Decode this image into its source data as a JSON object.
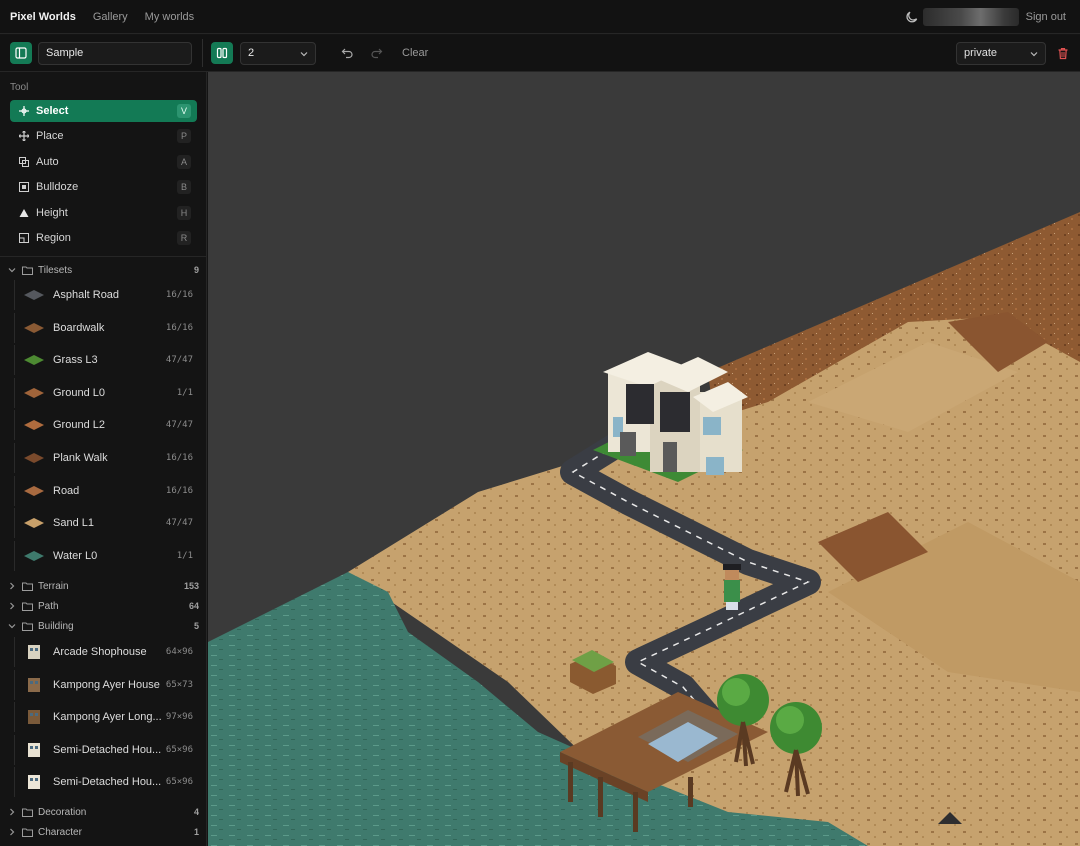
{
  "nav": {
    "brand": "Pixel Worlds",
    "links": [
      "Gallery",
      "My worlds"
    ],
    "sign_out": "Sign out"
  },
  "toolbar": {
    "world_name": "Sample",
    "layer_value": "2",
    "clear_label": "Clear",
    "visibility_value": "private"
  },
  "tools": {
    "section_label": "Tool",
    "items": [
      {
        "label": "Select",
        "key": "V",
        "icon": "crosshair-icon",
        "active": true
      },
      {
        "label": "Place",
        "key": "P",
        "icon": "move-icon"
      },
      {
        "label": "Auto",
        "key": "A",
        "icon": "copy-icon"
      },
      {
        "label": "Bulldoze",
        "key": "B",
        "icon": "bulldoze-icon"
      },
      {
        "label": "Height",
        "key": "H",
        "icon": "triangle-icon"
      },
      {
        "label": "Region",
        "key": "R",
        "icon": "region-icon"
      }
    ]
  },
  "groups": {
    "tilesets": {
      "label": "Tilesets",
      "count": "9",
      "expanded": true
    },
    "terrain": {
      "label": "Terrain",
      "count": "153",
      "expanded": false
    },
    "path": {
      "label": "Path",
      "count": "64",
      "expanded": false
    },
    "building": {
      "label": "Building",
      "count": "5",
      "expanded": true
    },
    "decoration": {
      "label": "Decoration",
      "count": "4",
      "expanded": false
    },
    "character": {
      "label": "Character",
      "count": "1",
      "expanded": false
    }
  },
  "tilesets": [
    {
      "label": "Asphalt Road",
      "count": "16/16",
      "color": "#55585e"
    },
    {
      "label": "Boardwalk",
      "count": "16/16",
      "color": "#8a5a34"
    },
    {
      "label": "Grass L3",
      "count": "47/47",
      "color": "#4d8a32"
    },
    {
      "label": "Ground L0",
      "count": "1/1",
      "color": "#a0643a"
    },
    {
      "label": "Ground L2",
      "count": "47/47",
      "color": "#b06c3e"
    },
    {
      "label": "Plank Walk",
      "count": "16/16",
      "color": "#7a4a2c"
    },
    {
      "label": "Road",
      "count": "16/16",
      "color": "#a86a40"
    },
    {
      "label": "Sand L1",
      "count": "47/47",
      "color": "#c8a06a"
    },
    {
      "label": "Water L0",
      "count": "1/1",
      "color": "#3e7a6c"
    }
  ],
  "buildings": [
    {
      "label": "Arcade Shophouse",
      "count": "64×96"
    },
    {
      "label": "Kampong Ayer House",
      "count": "65×73"
    },
    {
      "label": "Kampong Ayer Long...",
      "count": "97×96"
    },
    {
      "label": "Semi-Detached Hou...",
      "count": "65×96"
    },
    {
      "label": "Semi-Detached Hou...",
      "count": "65×96"
    }
  ],
  "colors": {
    "accent": "#137a55",
    "canvas_bg": "#3a3a3a",
    "water": "#3f7a6d",
    "sand": "#c6a26e",
    "dirt": "#8e5a32",
    "road": "#3a3d44"
  }
}
